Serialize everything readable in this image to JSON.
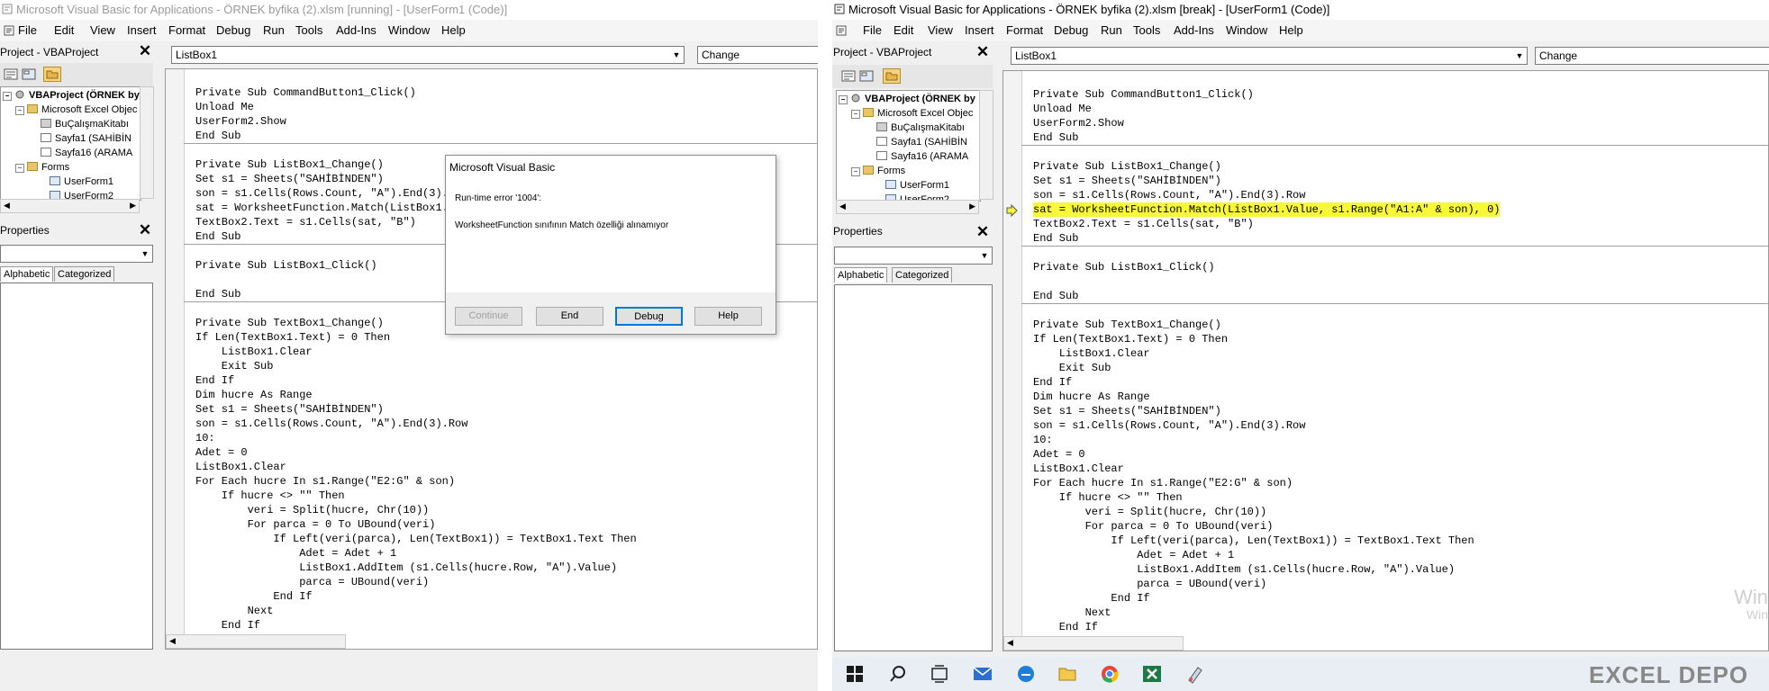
{
  "left": {
    "title": "Microsoft Visual Basic for Applications - ÖRNEK byfika (2).xlsm [running] - [UserForm1 (Code)]",
    "menu": [
      "File",
      "Edit",
      "View",
      "Insert",
      "Format",
      "Debug",
      "Run",
      "Tools",
      "Add-Ins",
      "Window",
      "Help"
    ],
    "project_title": "Project - VBAProject",
    "tree": {
      "root": "VBAProject (ÖRNEK by",
      "objects_folder": "Microsoft Excel Objec",
      "items": [
        "BuÇalışmaKitabı",
        "Sayfa1 (SAHİBİN",
        "Sayfa16 (ARAMA"
      ],
      "forms_folder": "Forms",
      "forms": [
        "UserForm1",
        "UserForm2"
      ]
    },
    "properties_title": "Properties",
    "tabs": {
      "alphabetic": "Alphabetic",
      "categorized": "Categorized"
    },
    "object_combo": "ListBox1",
    "proc_combo": "Change",
    "code": [
      "Private Sub CommandButton1_Click()",
      "Unload Me",
      "UserForm2.Show",
      "End Sub",
      "",
      "Private Sub ListBox1_Change()",
      "Set s1 = Sheets(\"SAHİBİNDEN\")",
      "son = s1.Cells(Rows.Count, \"A\").End(3).Row",
      "sat = WorksheetFunction.Match(ListBox1.Value, s1.Range(\"A1:A\" & son), 0)",
      "TextBox2.Text = s1.Cells(sat, \"B\")",
      "End Sub",
      "",
      "Private Sub ListBox1_Click()",
      "",
      "End Sub",
      "",
      "Private Sub TextBox1_Change()",
      "If Len(TextBox1.Text) = 0 Then",
      "    ListBox1.Clear",
      "    Exit Sub",
      "End If",
      "Dim hucre As Range",
      "Set s1 = Sheets(\"SAHİBİNDEN\")",
      "son = s1.Cells(Rows.Count, \"A\").End(3).Row",
      "10:",
      "Adet = 0",
      "ListBox1.Clear",
      "For Each hucre In s1.Range(\"E2:G\" & son)",
      "    If hucre <> \"\" Then",
      "        veri = Split(hucre, Chr(10))",
      "        For parca = 0 To UBound(veri)",
      "            If Left(veri(parca), Len(TextBox1)) = TextBox1.Text Then",
      "                Adet = Adet + 1",
      "                ListBox1.AddItem (s1.Cells(hucre.Row, \"A\").Value)",
      "                parca = UBound(veri)",
      "            End If",
      "        Next",
      "    End If"
    ],
    "dialog": {
      "title": "Microsoft Visual Basic",
      "error_line": "Run-time error '1004':",
      "message": "WorksheetFunction sınıfının Match özelliği alınamıyor",
      "buttons": {
        "continue": "Continue",
        "end": "End",
        "debug": "Debug",
        "help": "Help"
      }
    }
  },
  "right": {
    "title": "Microsoft Visual Basic for Applications - ÖRNEK byfika (2).xlsm [break] - [UserForm1 (Code)]",
    "menu": [
      "File",
      "Edit",
      "View",
      "Insert",
      "Format",
      "Debug",
      "Run",
      "Tools",
      "Add-Ins",
      "Window",
      "Help"
    ],
    "project_title": "Project - VBAProject",
    "tree": {
      "root": "VBAProject (ÖRNEK by",
      "objects_folder": "Microsoft Excel Objec",
      "items": [
        "BuÇalışmaKitabı",
        "Sayfa1 (SAHİBİN",
        "Sayfa16 (ARAMA"
      ],
      "forms_folder": "Forms",
      "forms": [
        "UserForm1",
        "UserForm2"
      ]
    },
    "properties_title": "Properties",
    "tabs": {
      "alphabetic": "Alphabetic",
      "categorized": "Categorized"
    },
    "object_combo": "ListBox1",
    "proc_combo": "Change",
    "highlight_index": 8,
    "watermark": "Win",
    "watermark2": "Win",
    "brand": "EXCEL DEPO",
    "colors": {
      "highlight": "#f8f83a",
      "dialog_default": "#0078d7"
    }
  },
  "taskbar_icons": [
    "windows-start-icon",
    "search-icon",
    "task-view-icon",
    "mail-icon",
    "edge-icon",
    "file-explorer-icon",
    "chrome-icon",
    "excel-icon",
    "paint-icon"
  ]
}
